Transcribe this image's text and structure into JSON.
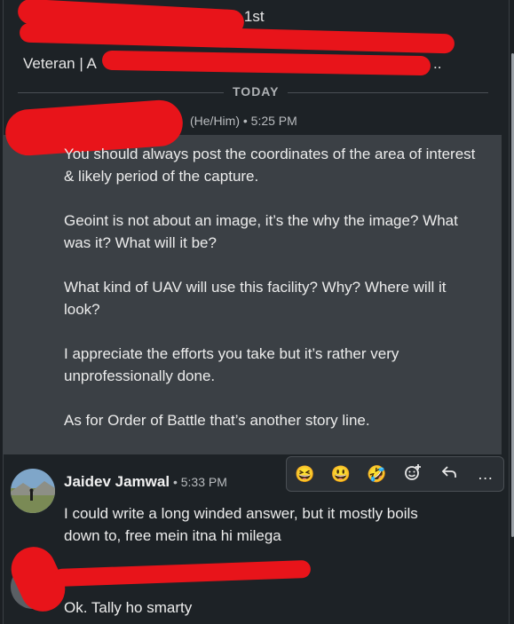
{
  "header": {
    "line1_suffix": "m) · 1st",
    "line3_prefix": "Veteran | A",
    "line3_suffix": ".."
  },
  "divider_label": "TODAY",
  "message1": {
    "meta": "(He/Him) • 5:25 PM",
    "paragraphs": [
      " You should always post the coordinates of the area of interest & likely period of the capture.",
      "Geoint is not about an image, it’s the why the image? What was it? What will it be?",
      "What kind of UAV will use this facility? Why? Where will it look?",
      "I appreciate the efforts you take but it’s rather very unprofessionally done.",
      "As for Order of Battle that’s another story line."
    ]
  },
  "message2": {
    "name": "Jaidev Jamwal",
    "time": " • 5:33 PM",
    "text": "I could write a long winded answer, but it mostly boils down to, free mein itna hi milega"
  },
  "message3": {
    "text": "Ok. Tally ho smarty"
  },
  "reactions": {
    "r1": "😆",
    "r2": "😃",
    "r3": "🤣",
    "more": "…"
  }
}
